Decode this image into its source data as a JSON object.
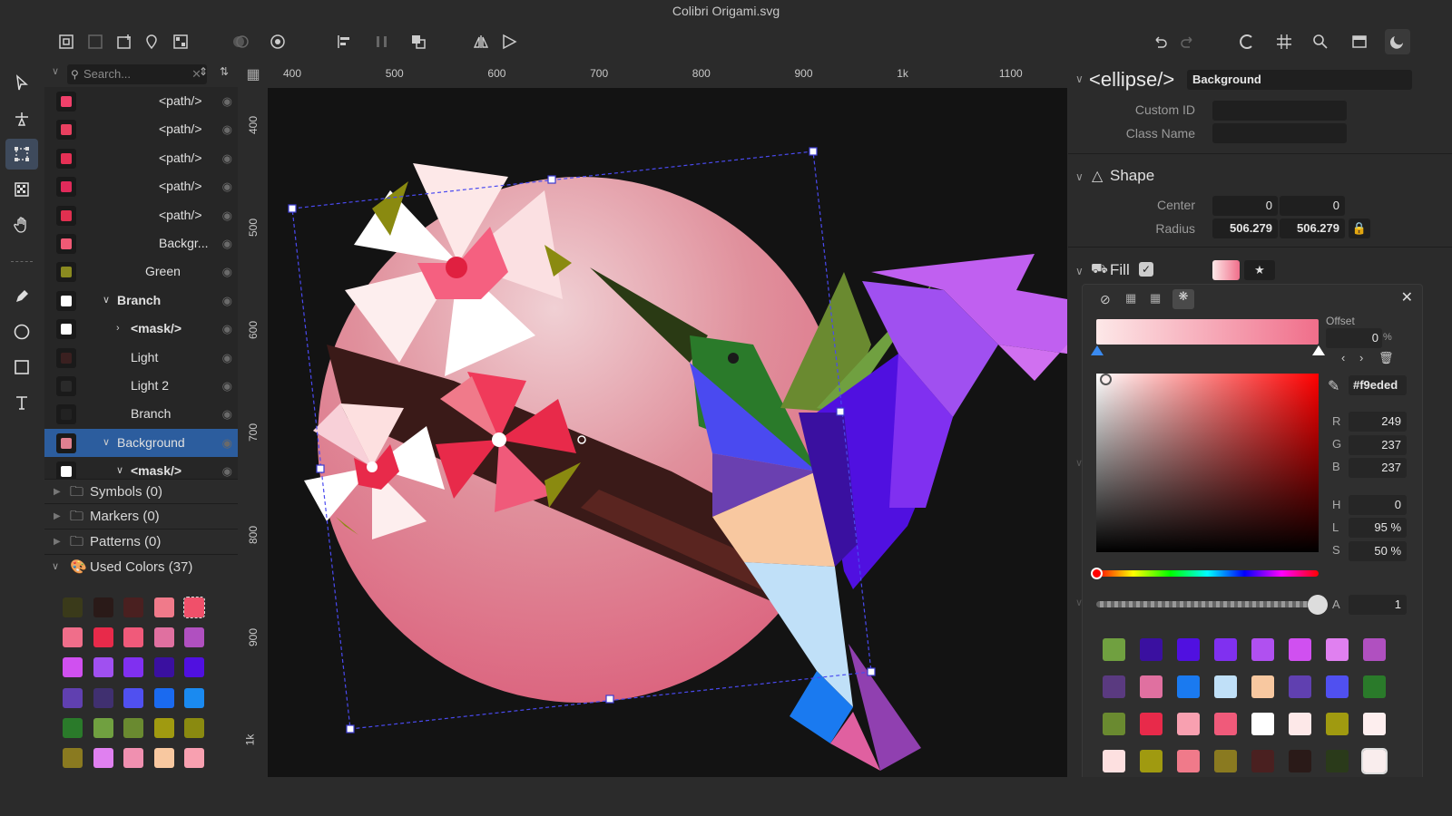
{
  "window": {
    "title": "Colibri Origami.svg"
  },
  "toolbar": {
    "icons": [
      "select-frame-icon",
      "ungroup-icon",
      "new-layer-icon",
      "add-pin-icon",
      "transparency-grid-icon",
      "boolean-ops-icon",
      "object-ops-icon",
      "align-left-icon",
      "distribute-icon",
      "arrange-icon",
      "flip-horizontal-icon",
      "flip-vertical-icon",
      "undo-icon",
      "redo-icon",
      "snap-icon",
      "grid-icon",
      "zoom-icon",
      "view-mode-icon",
      "theme-moon-icon"
    ]
  },
  "tools": [
    "select-arrow-icon",
    "node-edit-icon",
    "transform-icon",
    "gradient-icon",
    "hand-icon",
    "pen-icon",
    "ellipse-icon",
    "rect-icon",
    "text-icon"
  ],
  "layers": {
    "search_placeholder": "Search...",
    "rows": [
      {
        "label": "<path/>",
        "thumb": "#f0406a"
      },
      {
        "label": "<path/>",
        "thumb": "#e84060"
      },
      {
        "label": "<path/>",
        "thumb": "#e53055"
      },
      {
        "label": "<path/>",
        "thumb": "#e02a5a"
      },
      {
        "label": "<path/>",
        "thumb": "#e03050"
      },
      {
        "label": "Backgr...",
        "thumb": "#f05a75"
      },
      {
        "label": "Green",
        "thumb": "#8a8a20"
      },
      {
        "label": "Branch",
        "thumb": "#fff"
      },
      {
        "label": "<mask/>",
        "thumb": "#fff"
      },
      {
        "label": "Light",
        "thumb": "#3a2020"
      },
      {
        "label": "Light 2",
        "thumb": "#2a2a2a"
      },
      {
        "label": "Branch",
        "thumb": "#222"
      },
      {
        "label": "Background",
        "thumb": "#e08090"
      },
      {
        "label": "<mask/>",
        "thumb": "#fff"
      }
    ]
  },
  "sections": {
    "symbols": "Symbols (0)",
    "markers": "Markers (0)",
    "patterns": "Patterns (0)",
    "used_colors": "Used Colors (37)"
  },
  "used_colors": [
    "#3a3a1a",
    "#2a1a18",
    "#4a2020",
    "#f07a8a",
    "#f0506a",
    "#f06e8a",
    "#e82a4a",
    "#f05a7a",
    "#e070a0",
    "#b050c0",
    "#d050f0",
    "#a050f0",
    "#8030f0",
    "#3a10a0",
    "#5010e0",
    "#6040b0",
    "#403070",
    "#5050f0",
    "#1a6af0",
    "#1a8af0",
    "#2a7a2a",
    "#70a040",
    "#6a8a30",
    "#a09a10",
    "#8a8a10",
    "#8a7a20",
    "#e080f0",
    "#f090b0",
    "#f8c8a0",
    "#f8a0b0"
  ],
  "ruler": {
    "h": [
      "400",
      "500",
      "600",
      "700",
      "800",
      "900",
      "1k",
      "1100"
    ],
    "v": [
      "400",
      "500",
      "600",
      "700",
      "800",
      "900",
      "1k"
    ]
  },
  "inspector": {
    "element_tag": "<ellipse/>",
    "element_name": "Background",
    "custom_id_label": "Custom ID",
    "class_name_label": "Class Name",
    "shape_title": "Shape",
    "center_label": "Center",
    "center_x": "0",
    "center_y": "0",
    "radius_label": "Radius",
    "radius_x": "506.279",
    "radius_y": "506.279",
    "fill_title": "Fill"
  },
  "picker": {
    "offset_label": "Offset",
    "offset_value": "0",
    "offset_unit": "%",
    "hex": "#f9eded",
    "r_label": "R",
    "r": "249",
    "g_label": "G",
    "g": "237",
    "b_label": "B",
    "b": "237",
    "h_label": "H",
    "h": "0",
    "l_label": "L",
    "l": "95",
    "s_label": "S",
    "s": "50",
    "a_label": "A",
    "a": "1",
    "palette": [
      "#70a040",
      "#3a10a0",
      "#5010e0",
      "#8030f0",
      "#b050f0",
      "#d050f0",
      "#e080f0",
      "#b050c0",
      "#5a3a80",
      "#e070a0",
      "#1a7af0",
      "#c0e0f8",
      "#f8c8a0",
      "#6040b0",
      "#5050f0",
      "#2a7a2a",
      "#6a8a30",
      "#e82a4a",
      "#f8a0b0",
      "#f05a7a",
      "#ffffff",
      "#fde8e8",
      "#a09a10",
      "#fdeeee",
      "#fde0e0",
      "#a09a10",
      "#f07a8a",
      "#8a7a20",
      "#4a2020",
      "#2a1a18",
      "#2a3a1a",
      "#f9eded",
      "#f0506a",
      "#f8c0c8",
      "#f890a8",
      "#fdd8e0",
      "#1a8af0"
    ]
  }
}
